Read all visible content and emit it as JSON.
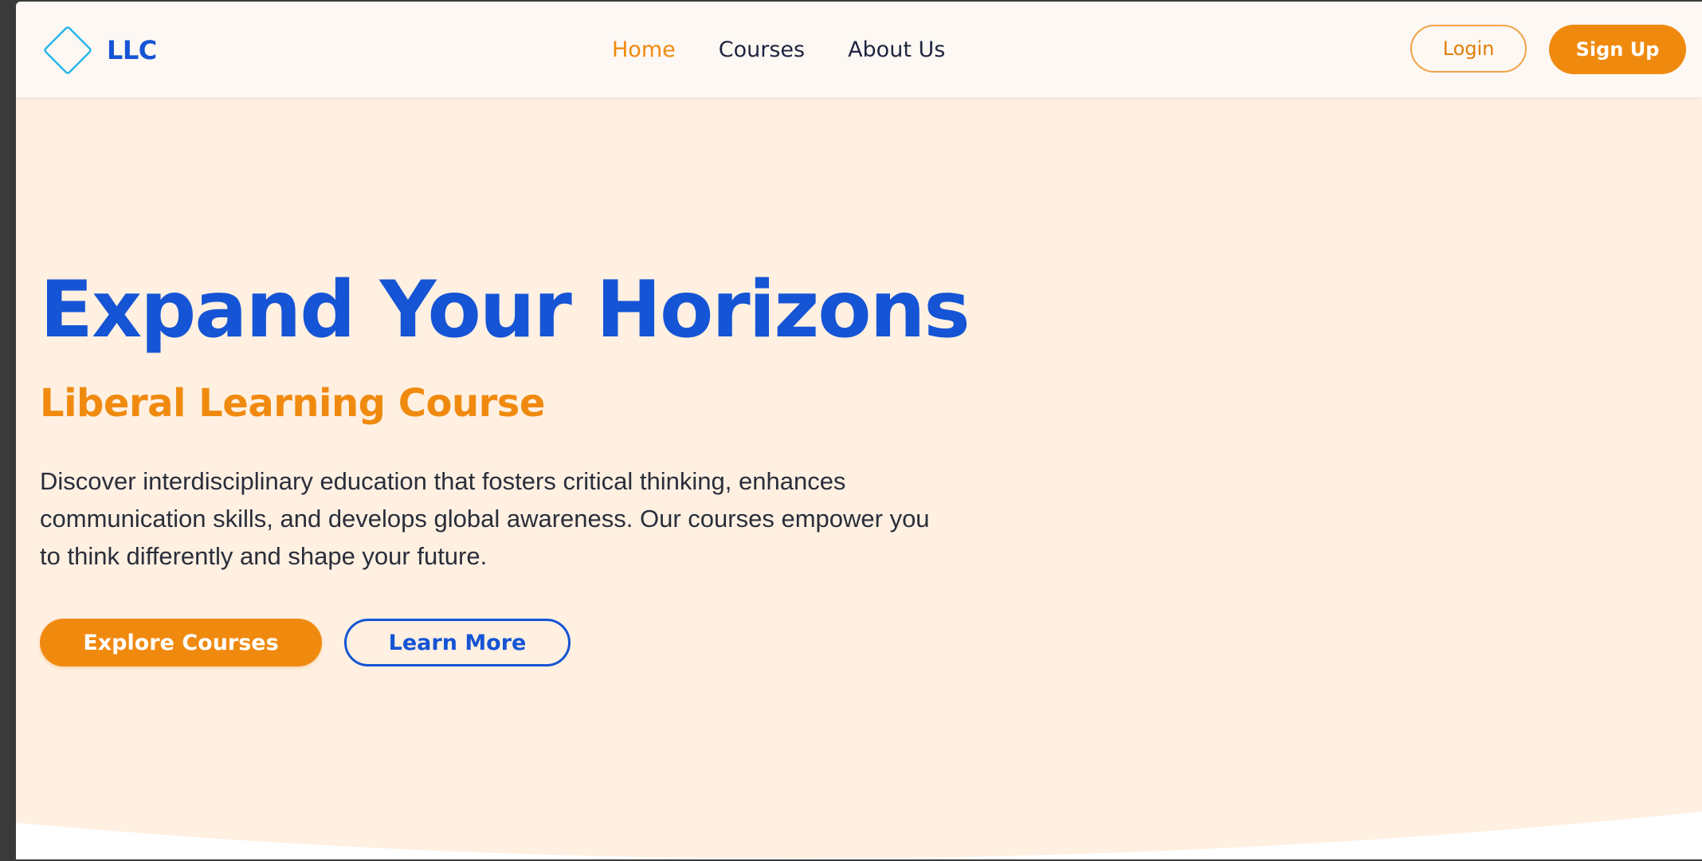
{
  "brand": {
    "name": "LLC",
    "logo_icon": "diamond-outline-icon"
  },
  "nav": {
    "links": [
      {
        "label": "Home",
        "active": true
      },
      {
        "label": "Courses",
        "active": false
      },
      {
        "label": "About Us",
        "active": false
      }
    ],
    "login_label": "Login",
    "signup_label": "Sign Up"
  },
  "hero": {
    "title": "Expand Your Horizons",
    "subtitle": "Liberal Learning Course",
    "description": "Discover interdisciplinary education that fosters critical thinking, enhances communication skills, and develops global awareness. Our courses empower you to think differently and shape your future.",
    "primary_button": "Explore Courses",
    "secondary_button": "Learn More"
  },
  "colors": {
    "primary_blue": "#1554d4",
    "accent_orange": "#f08a0f",
    "hero_background": "#fff0e2",
    "navbar_background": "#fdf8f3",
    "logo_cyan": "#29b6e8"
  }
}
